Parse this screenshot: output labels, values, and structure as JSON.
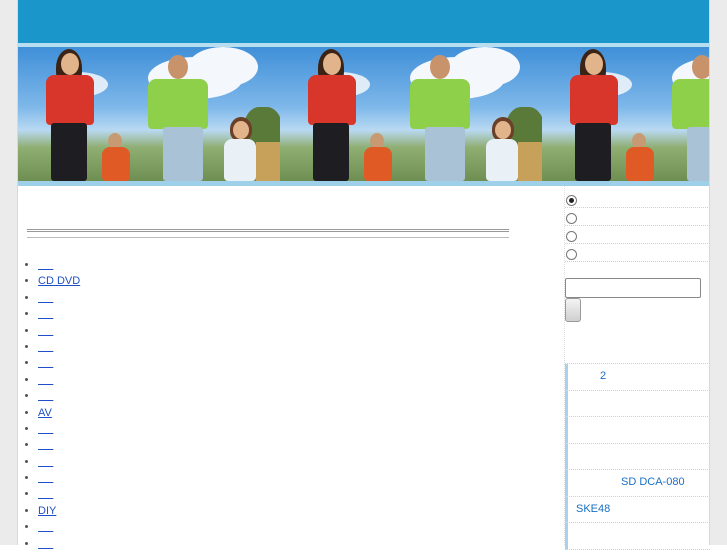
{
  "colors": {
    "header": "#1a96cb",
    "header_line": "#b6def0",
    "banner_bottom": "#9fd0ea",
    "link": "#1f4fc4",
    "sidebar_link": "#1a6fc4",
    "sidebar_accent": "#a9d2ea"
  },
  "banner": {
    "image": "family-walking-photo",
    "tiles": 3
  },
  "main": {
    "links": [
      {
        "label": "",
        "icon": "bullet-icon"
      },
      {
        "label": "CD DVD",
        "icon": "bullet-icon"
      },
      {
        "label": "",
        "icon": "bullet-icon"
      },
      {
        "label": "",
        "icon": "bullet-icon"
      },
      {
        "label": "",
        "icon": "bullet-icon"
      },
      {
        "label": "",
        "icon": "bullet-icon"
      },
      {
        "label": "",
        "icon": "bullet-icon"
      },
      {
        "label": "",
        "icon": "bullet-icon"
      },
      {
        "label": "",
        "icon": "bullet-icon"
      },
      {
        "label": "AV",
        "icon": "bullet-icon"
      },
      {
        "label": "",
        "icon": "bullet-icon"
      },
      {
        "label": "",
        "icon": "bullet-icon"
      },
      {
        "label": "",
        "icon": "bullet-icon"
      },
      {
        "label": "",
        "icon": "bullet-icon"
      },
      {
        "label": "",
        "icon": "bullet-icon"
      },
      {
        "label": "DIY",
        "icon": "bullet-icon"
      },
      {
        "label": "",
        "icon": "bullet-icon"
      },
      {
        "label": "",
        "icon": "bullet-icon"
      }
    ]
  },
  "sidebar": {
    "search": {
      "radio_options": [
        {
          "checked": true
        },
        {
          "checked": false
        },
        {
          "checked": false
        },
        {
          "checked": false
        }
      ],
      "input_value": "",
      "button_label": ""
    },
    "news": [
      {
        "text": "2"
      },
      {
        "text": ""
      },
      {
        "text": ""
      },
      {
        "text": ""
      },
      {
        "text": "SD DCA-080"
      },
      {
        "text": "SKE48"
      },
      {
        "text": ""
      }
    ]
  }
}
